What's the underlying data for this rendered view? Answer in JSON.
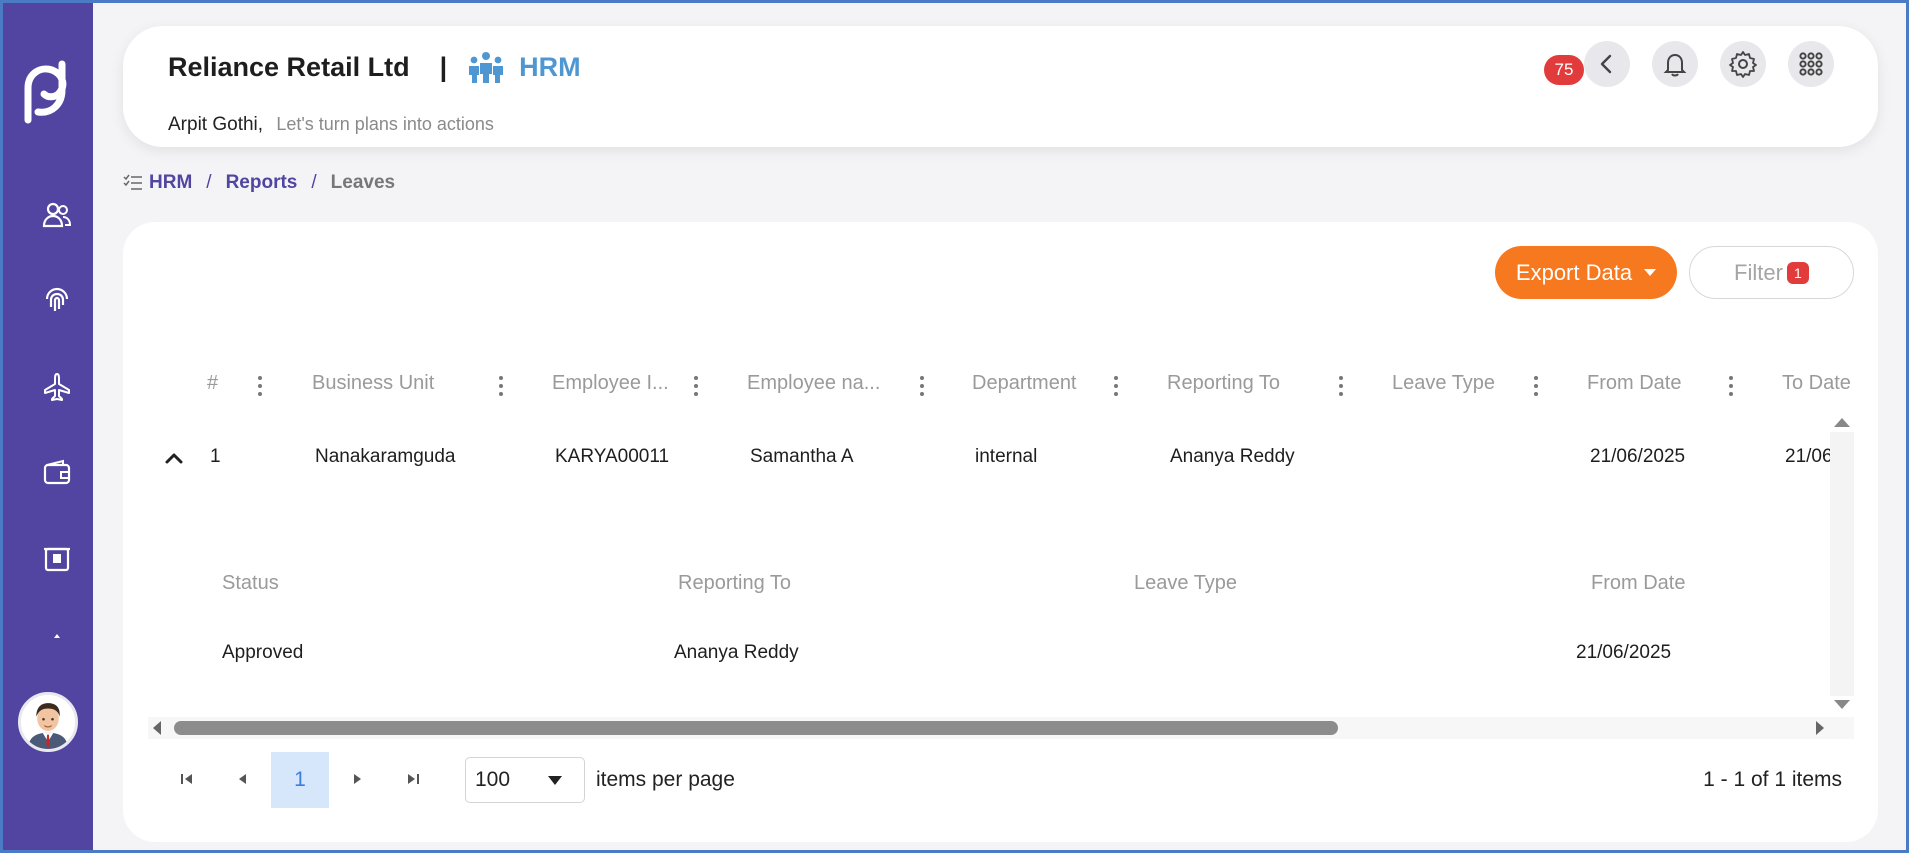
{
  "header": {
    "company": "Reliance Retail Ltd",
    "separator": "|",
    "module": "HRM",
    "user_name": "Arpit Gothi,",
    "tagline": "Let's turn plans into actions",
    "notification_count": "75"
  },
  "breadcrumb": {
    "items": [
      "HRM",
      "Reports",
      "Leaves"
    ],
    "sep": "/"
  },
  "toolbar": {
    "export_label": "Export Data",
    "filter_label": "Filter",
    "filter_count": "1"
  },
  "grid": {
    "columns": [
      "#",
      "Business Unit",
      "Employee I...",
      "Employee na...",
      "Department",
      "Reporting To",
      "Leave Type",
      "From Date",
      "To Date"
    ],
    "row": {
      "index": "1",
      "business_unit": "Nanakaramguda",
      "employee_id": "KARYA00011",
      "employee_name": "Samantha A",
      "department": "internal",
      "reporting_to": "Ananya Reddy",
      "leave_type": "",
      "from_date": "21/06/2025",
      "to_date": "21/06"
    },
    "detail": {
      "headers": [
        "Status",
        "Reporting To",
        "Leave Type",
        "From Date"
      ],
      "values": [
        "Approved",
        "Ananya Reddy",
        "",
        "21/06/2025"
      ]
    }
  },
  "pager": {
    "current_page": "1",
    "page_size": "100",
    "per_page_label": "items per page",
    "info": "1 - 1 of 1 items"
  },
  "colors": {
    "sidebar": "#5145a1",
    "accent_orange": "#f7791f",
    "hrm_blue": "#4f97d2",
    "badge_red": "#e23b3b"
  },
  "icons": {
    "sidebar": [
      "logo-icon",
      "users-icon",
      "fingerprint-icon",
      "plane-icon",
      "wallet-icon",
      "id-card-icon",
      "caret-up-icon"
    ],
    "header": [
      "back-icon",
      "bell-icon",
      "gear-icon",
      "apps-grid-icon"
    ]
  }
}
